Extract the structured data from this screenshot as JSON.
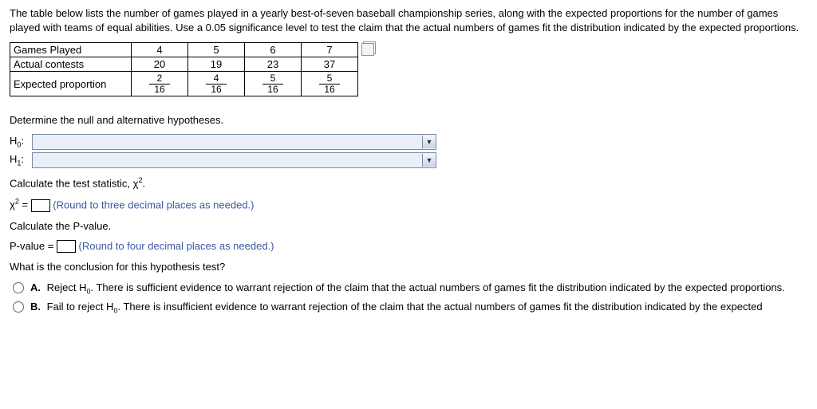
{
  "intro": "The table below lists the number of games played in a yearly best-of-seven baseball championship series, along with the expected proportions for the number of games played with teams of equal abilities. Use a 0.05 significance level to test the claim that the actual numbers of games fit the distribution indicated by the expected proportions.",
  "table": {
    "row1_label": "Games Played",
    "row2_label": "Actual contests",
    "row3_label": "Expected proportion",
    "games": [
      "4",
      "5",
      "6",
      "7"
    ],
    "actual": [
      "20",
      "19",
      "23",
      "37"
    ],
    "expected_num": [
      "2",
      "4",
      "5",
      "5"
    ],
    "expected_den": [
      "16",
      "16",
      "16",
      "16"
    ]
  },
  "q_hypotheses": "Determine the null and alternative hypotheses.",
  "h0_label": "H",
  "h0_sub": "0",
  "h1_label": "H",
  "h1_sub": "1",
  "colon": ":",
  "q_stat_intro": "Calculate the test statistic, χ",
  "q_stat_sup": "2",
  "q_stat_period": ".",
  "chi_label": "χ",
  "chi_sup": "2",
  "equals": " = ",
  "chi_hint": "(Round to three decimal places as needed.)",
  "q_pvalue": "Calculate the P-value.",
  "pvalue_label": "P-value = ",
  "pvalue_hint": "(Round to four decimal places as needed.)",
  "q_conclusion": "What is the conclusion for this hypothesis test?",
  "options": {
    "a_letter": "A.",
    "a_prefix": "Reject H",
    "a_sub": "0",
    "a_rest": ". There is sufficient evidence to warrant rejection of the claim that the actual numbers of games fit the distribution indicated by the expected proportions.",
    "b_letter": "B.",
    "b_prefix": "Fail to reject H",
    "b_sub": "0",
    "b_rest": ". There is insufficient evidence to warrant rejection of the claim that the actual numbers of games fit the distribution indicated by the expected"
  },
  "dropdown_arrow": "▼"
}
